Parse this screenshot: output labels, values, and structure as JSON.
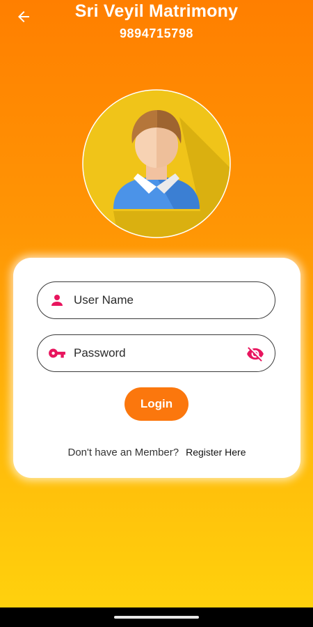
{
  "header": {
    "title": "Sri Veyil Matrimony",
    "phone": "9894715798"
  },
  "icons": {
    "back": "arrow-left-icon",
    "avatar": "user-avatar-icon",
    "user": "person-icon",
    "password": "key-icon",
    "visibility": "eye-off-icon"
  },
  "login_form": {
    "username_placeholder": "User Name",
    "password_placeholder": "Password",
    "login_label": "Login",
    "register_prompt": "Don't have an Member?",
    "register_link": "Register Here"
  },
  "colors": {
    "accent": "#fb770d",
    "icon_pink": "#e8155e",
    "gradient_top": "#ff7f00",
    "gradient_bottom": "#ffd10d"
  }
}
